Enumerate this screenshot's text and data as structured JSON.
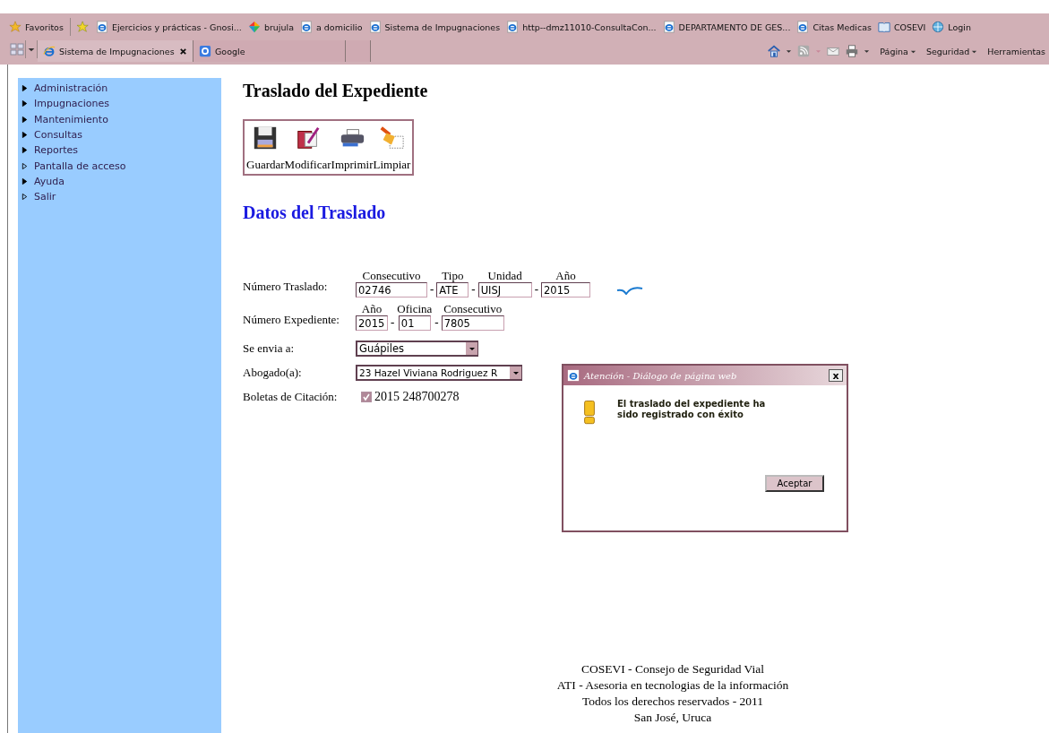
{
  "favorites_bar": {
    "label": "Favoritos",
    "links": [
      "Ejercicios y prácticas - Gnosi...",
      "brujula",
      "a domicilio",
      "Sistema de Impugnaciones",
      "http--dmz11010-ConsultaCon...",
      "DEPARTAMENTO DE GES...",
      "Citas Medicas",
      "COSEVI",
      "Login"
    ]
  },
  "tabs": [
    {
      "label": "Sistema de Impugnaciones",
      "selected": true
    },
    {
      "label": "Google",
      "selected": false
    }
  ],
  "command_bar": [
    "Página",
    "Seguridad",
    "Herramientas"
  ],
  "sidebar": {
    "items": [
      {
        "label": "Administración",
        "has_submenu": true
      },
      {
        "label": "Impugnaciones",
        "has_submenu": true
      },
      {
        "label": "Mantenimiento",
        "has_submenu": true
      },
      {
        "label": "Consultas",
        "has_submenu": true
      },
      {
        "label": "Reportes",
        "has_submenu": true
      },
      {
        "label": "Pantalla de acceso",
        "has_submenu": false
      },
      {
        "label": "Ayuda",
        "has_submenu": true
      },
      {
        "label": "Salir",
        "has_submenu": false
      }
    ]
  },
  "page": {
    "title": "Traslado del Expediente",
    "toolbar": [
      "Guardar",
      "Modificar",
      "Imprimir",
      "Limpiar"
    ],
    "section_title": "Datos del Traslado",
    "numero_traslado": {
      "label": "Número Traslado:",
      "separator": "-",
      "fields": [
        {
          "header": "Consecutivo",
          "value": "02746"
        },
        {
          "header": "Tipo",
          "value": "ATE"
        },
        {
          "header": "Unidad",
          "value": "UISJ"
        },
        {
          "header": "Año",
          "value": "2015"
        }
      ]
    },
    "numero_expediente": {
      "label": "Número Expediente:",
      "separator": "-",
      "fields": [
        {
          "header": "Año",
          "value": "2015"
        },
        {
          "header": "Oficina",
          "value": "01"
        },
        {
          "header": "Consecutivo",
          "value": "7805"
        }
      ]
    },
    "se_envia": {
      "label": "Se envia a:",
      "value": "Guápiles"
    },
    "abogado": {
      "label": "Abogado(a):",
      "value": "23 Hazel Viviana Rodriguez R"
    },
    "boletas": {
      "label": "Boletas de Citación:",
      "checked": true,
      "disabled": true,
      "value": "2015 248700278"
    },
    "footer": [
      "COSEVI - Consejo de Seguridad Vial",
      "ATI - Asesoria en tecnologias de la información",
      "Todos los derechos reservados - 2011",
      "San José, Uruca"
    ]
  },
  "dialog": {
    "title": "Atención - Diálogo de página web",
    "close": "x",
    "message": "El traslado del expediente ha sido registrado con éxito",
    "button": "Aceptar"
  }
}
